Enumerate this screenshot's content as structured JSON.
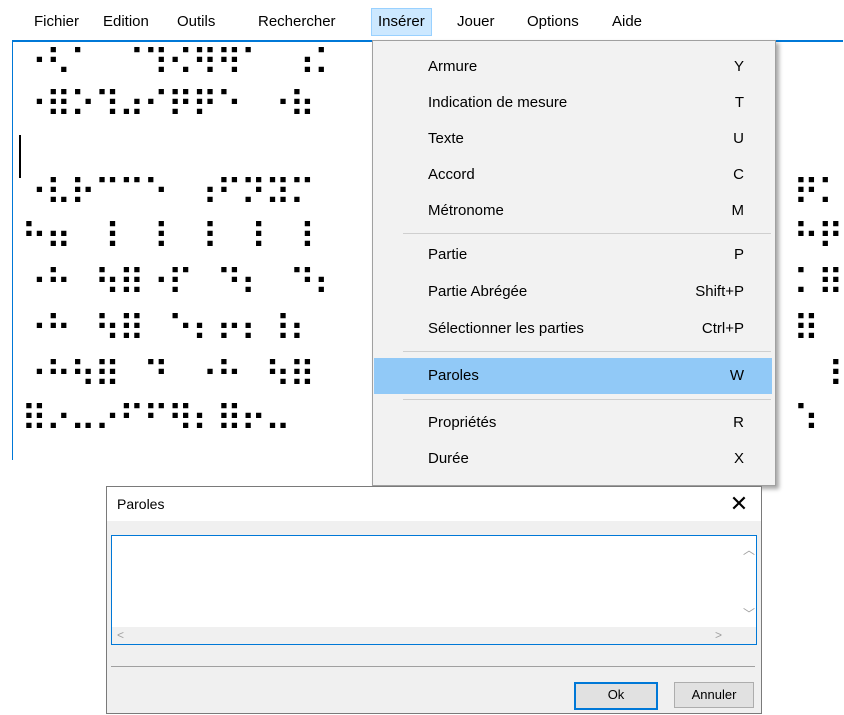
{
  "menubar": {
    "items": [
      "Fichier",
      "Edition",
      "Outils",
      "Rechercher",
      "Insérer",
      "Jouer",
      "Options",
      "Aide"
    ],
    "open_item": "Insérer"
  },
  "editor": {
    "braille_lines": [
      "⠐⠣⠁⠀⠈⠹⠪⠻⠻⠁⠀⠰⠅",
      "⠐⠿⠕⠹⠴⠊⠟⠟⠑⠀⠐⠷",
      "",
      "⠐⠧⠗⠉⠉⠑⠀⠰⠋⠝⠽⠍",
      "⠓⠶⠀⠸⠀⠸⠀⠸⠀⠸⠀⠸",
      "⠐⠓⠀⠳⠿⠐⠏⠀⠙⠆⠀⠙⠆",
      "⠐⠓⠀⠳⠿⠀⠑⠆⠖⠆⠸⠆",
      "⠐⠓⠳⠿⠀⠙⠀⠐⠓⠀⠳⠿",
      "⠿⠔⠤⠔⠋⠋⠻⠆⠿⠖⠤⠀"
    ],
    "braille_right": [
      "",
      "",
      "",
      "⠟⠅",
      "⠓⠟",
      "⠅⠿",
      "⠿⠀⠄",
      "⠀⠸",
      "⠱⠀⠅"
    ]
  },
  "dropdown": {
    "items": [
      {
        "label": "Armure",
        "shortcut": "Y"
      },
      {
        "label": "Indication de mesure",
        "shortcut": "T"
      },
      {
        "label": "Texte",
        "shortcut": "U"
      },
      {
        "label": "Accord",
        "shortcut": "C"
      },
      {
        "label": "Métronome",
        "shortcut": "M"
      },
      {
        "label": "Partie",
        "shortcut": "P"
      },
      {
        "label": "Partie Abrégée",
        "shortcut": "Shift+P"
      },
      {
        "label": "Sélectionner les parties",
        "shortcut": "Ctrl+P"
      },
      {
        "label": "Paroles",
        "shortcut": "W"
      },
      {
        "label": "Propriétés",
        "shortcut": "R"
      },
      {
        "label": "Durée",
        "shortcut": "X"
      }
    ],
    "highlighted": "Paroles",
    "highlight_color": "#91c9f7"
  },
  "dialog": {
    "title": "Paroles",
    "close_glyph": "✕",
    "text_value": "",
    "ok_label": "Ok",
    "cancel_label": "Annuler",
    "accent_color": "#0078d7"
  }
}
